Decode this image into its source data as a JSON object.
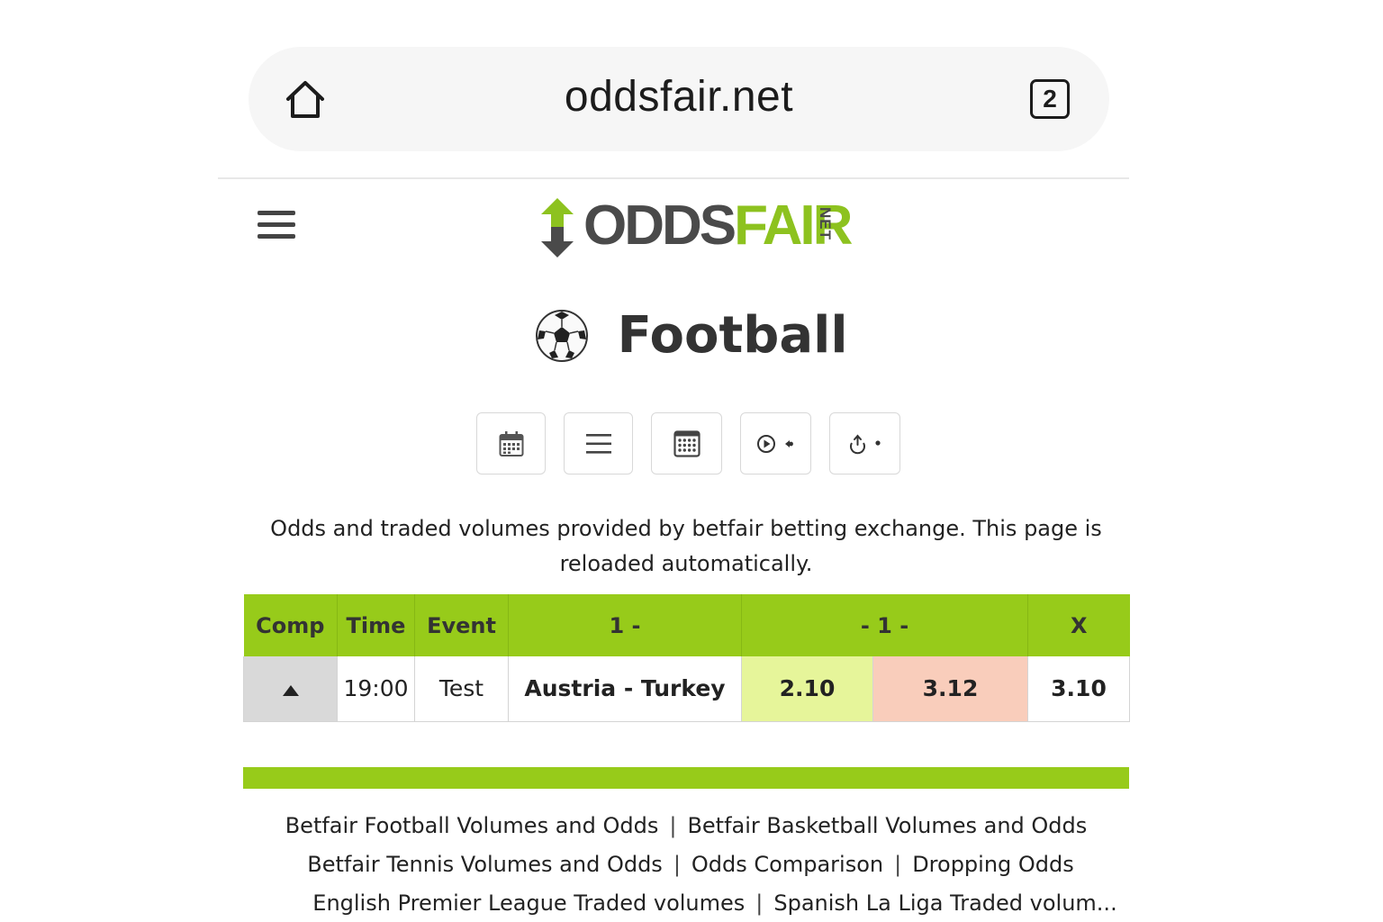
{
  "browser": {
    "url": "oddsfair.net",
    "tab_count": "2",
    "home_icon": "home-icon"
  },
  "header": {
    "menu_icon": "hamburger-icon",
    "logo": {
      "part1": "ODDS",
      "part2": "FAIR",
      "suffix": "NET",
      "brand_gray": "#4a4a4a",
      "brand_green": "#8dc21f"
    }
  },
  "page": {
    "title": "Football",
    "sport_icon": "soccer-ball-icon",
    "toolbar_icons": [
      "calendar-icon",
      "list-icon",
      "grid-calendar-icon",
      "live-play-icon",
      "trending-icon"
    ],
    "description": "Odds and traded volumes provided by betfair betting exchange. This page is reloaded automatically."
  },
  "table": {
    "headers": [
      "Comp",
      "Time",
      "Event",
      "1 -",
      "- 1 -",
      "X"
    ],
    "rows": [
      {
        "comp_icon": "triangle-up-icon",
        "time": "19:00",
        "event": "Test",
        "match": "Austria - Turkey",
        "back": "2.10",
        "lay": "3.12",
        "x": "3.10"
      }
    ],
    "colors": {
      "header": "#97cb1a",
      "back": "#e6f59a",
      "lay": "#f9cdbb",
      "comp_cell": "#d9d9d9"
    }
  },
  "footer": {
    "links": [
      "Betfair Football Volumes and Odds",
      "Betfair Basketball Volumes and Odds",
      "Betfair Tennis Volumes and Odds",
      "Odds Comparison",
      "Dropping Odds",
      "English Premier League Traded volumes",
      "Spanish La Liga Traded volum..."
    ],
    "separator": "|"
  }
}
